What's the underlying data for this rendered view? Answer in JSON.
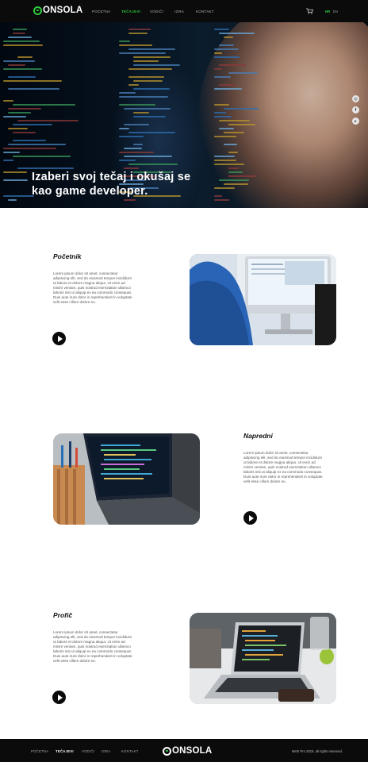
{
  "header": {
    "logo_text": "ONSOLA",
    "nav": [
      {
        "label": "POČETNA"
      },
      {
        "label": "TEČAJEVI"
      },
      {
        "label": "VODIČI"
      },
      {
        "label": "IGRA"
      },
      {
        "label": "KONTAKT"
      }
    ],
    "lang_hr": "HR",
    "lang_en": "EN"
  },
  "hero": {
    "title": "Izaberi svoj tečaj i okušaj se kao game developer.",
    "social": [
      "instagram-icon",
      "facebook-icon",
      "youtube-icon"
    ]
  },
  "courses": [
    {
      "title": "Početnik",
      "description": "Lorem ipsum dolor sit amet, consectetur adipiscing elit, sed do eiusmod tempor incididunt ut labore et dolore magna aliqua. Ut enim ad minim veniam, quis nostrud exercitation ullamco laboris nisi ut aliquip ex ea commodo consequat. Duis aute irure dolor in reprehenderit in voluptate velit esse cillum dolore eu."
    },
    {
      "title": "Napredni",
      "description": "Lorem ipsum dolor sit amet, consectetur adipiscing elit, sed do eiusmod tempor incididunt ut labore et dolore magna aliqua. Ut enim ad minim veniam, quis nostrud exercitation ullamco laboris nisi ut aliquip ex ea commodo consequat. Duis aute irure dolor in reprehenderit in voluptate velit esse cillum dolore eu."
    },
    {
      "title": "Profič",
      "description": "Lorem ipsum dolor sit amet, consectetur adipiscing elit, sed do eiusmod tempor incididunt ut labore et dolore magna aliqua. Ut enim ad minim veniam, quis nostrud exercitation ullamco laboris nisi ut aliquip ex ea commodo consequat. Duis aute irure dolor in reprehenderit in voluptate velit esse cillum dolore eu."
    }
  ],
  "footer": {
    "nav": [
      {
        "label": "POČETNA"
      },
      {
        "label": "TEČAJEVI"
      },
      {
        "label": "VODIČI"
      },
      {
        "label": "IGRA"
      },
      {
        "label": "KONTAKT"
      }
    ],
    "logo_text": "ONSOLA",
    "copyright": "MHS Pro 2018, all rights reserved."
  },
  "colors": {
    "accent": "#2ecc40",
    "header_bg": "#0b0b0b"
  }
}
